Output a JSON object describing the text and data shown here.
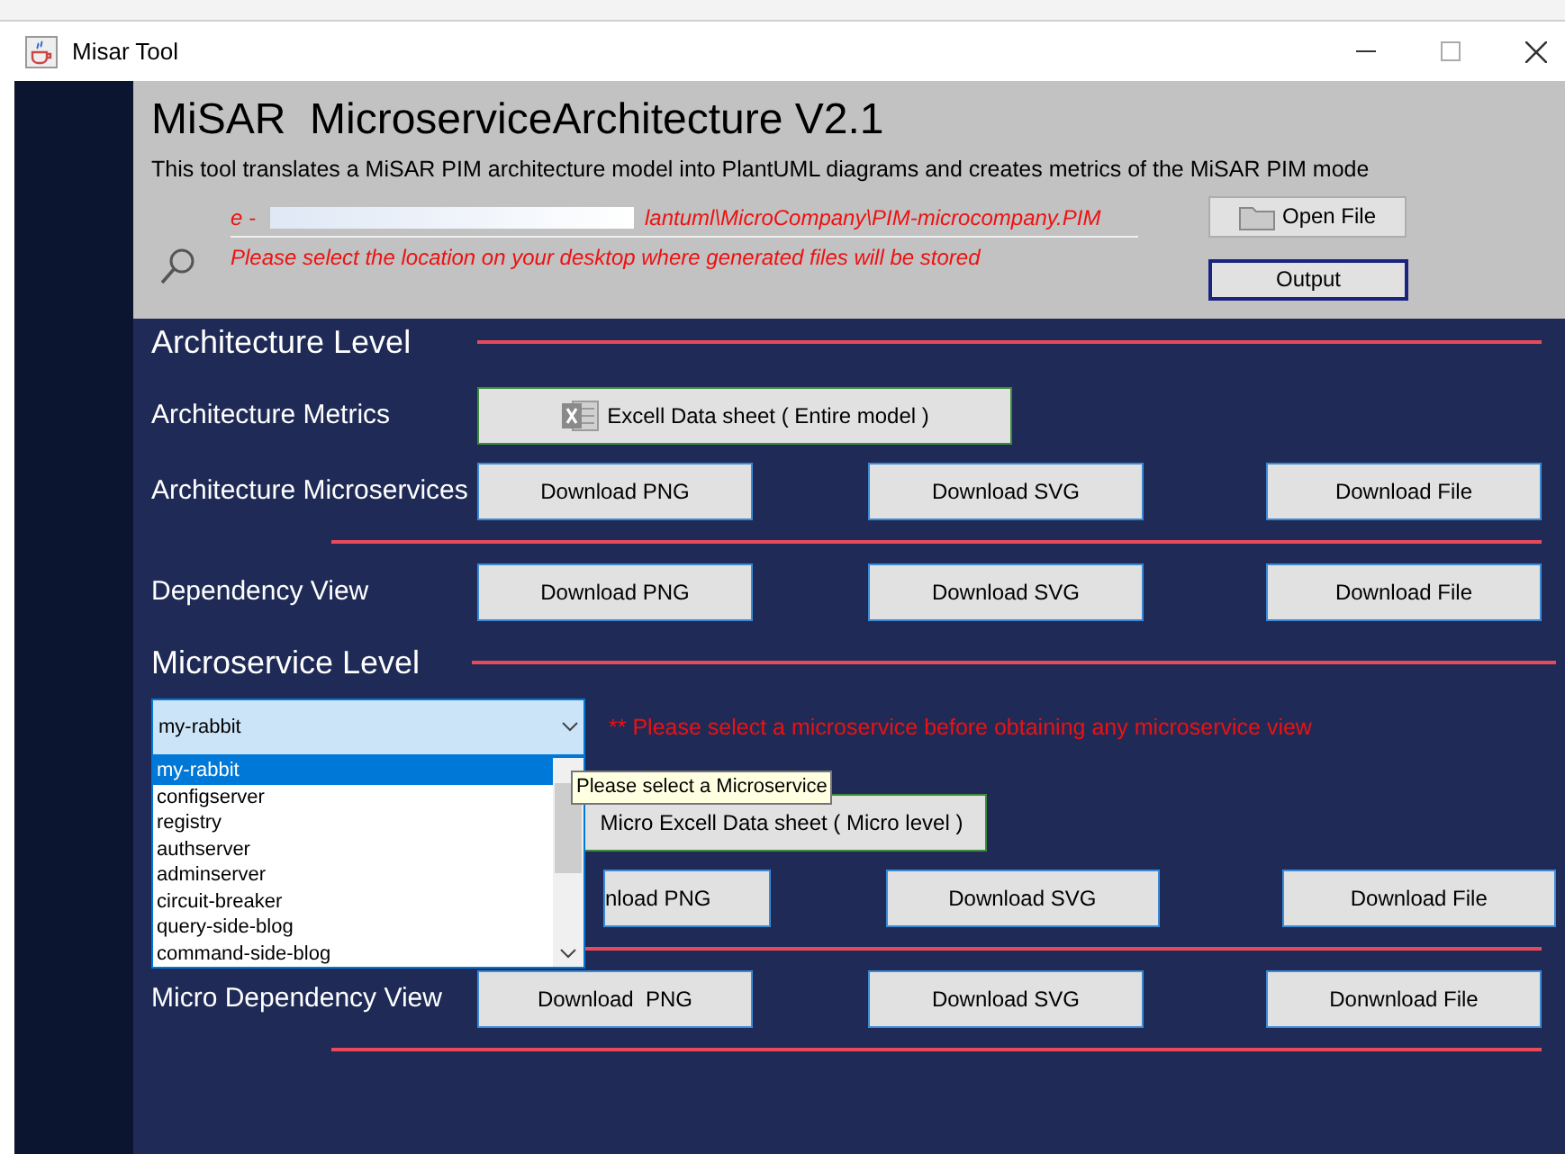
{
  "window": {
    "title": "Misar Tool"
  },
  "header": {
    "title": "MiSAR  MicroserviceArchitecture V2.1",
    "description": "This tool translates a MiSAR PIM architecture model into PlantUML diagrams and creates metrics of the MiSAR PIM mode",
    "file_path_start": "e -",
    "file_path_end": "lantuml\\MicroCompany\\PIM-microcompany.PIM",
    "output_hint": "Please select the location on your desktop where generated files will be stored",
    "open_file_button": "Open File",
    "output_button": "Output"
  },
  "architecture_level": {
    "heading": "Architecture Level",
    "rows": [
      {
        "kind": "excel",
        "label": "Architecture Metrics",
        "buttons": [
          "Excell Data sheet ( Entire model )"
        ],
        "divider": false
      },
      {
        "kind": "downloads",
        "label": "Architecture Microservices",
        "buttons": [
          "Download PNG",
          "Download SVG",
          "Download File"
        ],
        "divider": true
      },
      {
        "kind": "downloads",
        "label": "Dependency View",
        "buttons": [
          "Download PNG",
          "Download SVG",
          "Download File"
        ],
        "divider": false
      }
    ]
  },
  "microservice_level": {
    "heading": "Microservice Level",
    "combo": {
      "value": "my-rabbit",
      "expanded": true,
      "options": [
        {
          "label": "my-rabbit",
          "selected": true
        },
        {
          "label": "configserver",
          "selected": false
        },
        {
          "label": "registry",
          "selected": false
        },
        {
          "label": "authserver",
          "selected": false
        },
        {
          "label": "adminserver",
          "selected": false
        },
        {
          "label": "circuit-breaker",
          "selected": false
        },
        {
          "label": "query-side-blog",
          "selected": false
        },
        {
          "label": "command-side-blog",
          "selected": false
        }
      ]
    },
    "warning": "** Please select a microservice before obtaining any microservice view",
    "tooltip": "Please select a Microservice",
    "rows": [
      {
        "kind": "excel",
        "buttons": [
          "Micro Excell Data sheet ( Micro level )"
        ],
        "divider": false
      },
      {
        "kind": "downloads",
        "buttons": [
          "nload PNG",
          "Download SVG",
          "Download File"
        ],
        "divider": true
      },
      {
        "kind": "downloads",
        "label": "Micro Dependency View",
        "buttons": [
          "Download  PNG",
          "Download SVG",
          "Donwnload File"
        ],
        "divider": true
      }
    ]
  }
}
